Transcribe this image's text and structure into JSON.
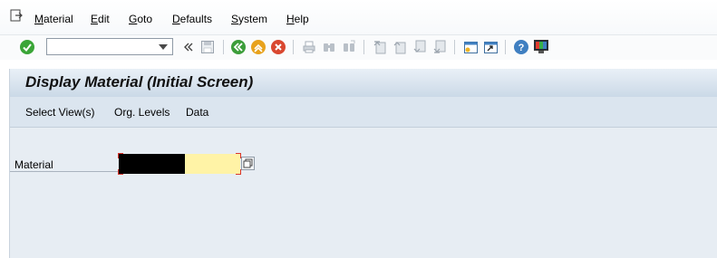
{
  "menu": {
    "items": [
      {
        "label": "Material",
        "mnemonic": "M",
        "rest": "aterial"
      },
      {
        "label": "Edit",
        "mnemonic": "E",
        "rest": "dit"
      },
      {
        "label": "Goto",
        "mnemonic": "G",
        "rest": "oto"
      },
      {
        "label": "Defaults",
        "mnemonic": "D",
        "rest": "efaults"
      },
      {
        "label": "System",
        "mnemonic": "S",
        "rest": "ystem"
      },
      {
        "label": "Help",
        "mnemonic": "H",
        "rest": "elp"
      }
    ]
  },
  "toolbar": {
    "command_field_value": "",
    "icons": [
      "enter-icon",
      "command-dropdown-icon",
      "collapse-icon",
      "save-icon",
      "back-icon",
      "exit-icon",
      "cancel-icon",
      "print-icon",
      "find-icon",
      "find-next-icon",
      "first-page-icon",
      "previous-page-icon",
      "next-page-icon",
      "last-page-icon",
      "create-session-icon",
      "shortcut-icon",
      "help-icon",
      "customize-layout-icon"
    ],
    "colors": {
      "enter": "#3aa537",
      "back": "#3c9d3a",
      "exit": "#e8a21c",
      "cancel": "#d9472f",
      "help": "#3f7fc1"
    }
  },
  "title": "Display Material (Initial Screen)",
  "app_toolbar": {
    "buttons": [
      "Select View(s)",
      "Org. Levels",
      "Data"
    ]
  },
  "form": {
    "material_label": "Material",
    "material_value": ""
  },
  "colors": {
    "title_bg": "#cbd9e7",
    "app_bar_bg": "#dbe5ef",
    "content_bg": "#e7edf3",
    "required_field_bg": "#fff3a6",
    "required_marker": "#d9352c"
  }
}
